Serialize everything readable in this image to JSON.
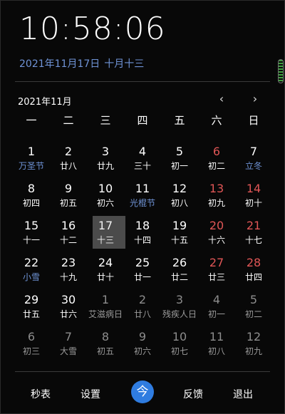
{
  "clock": {
    "time": "10:58:06"
  },
  "date_line": {
    "solar": "2021年11月17日",
    "lunar": "十月十三"
  },
  "month": {
    "label": "2021年11月",
    "prev_icon": "‹",
    "next_icon": "›"
  },
  "weekdays": [
    "一",
    "二",
    "三",
    "四",
    "五",
    "六",
    "日"
  ],
  "days": [
    {
      "n": "1",
      "l": "万圣节",
      "t": "festival"
    },
    {
      "n": "2",
      "l": "廿八",
      "t": ""
    },
    {
      "n": "3",
      "l": "廿九",
      "t": ""
    },
    {
      "n": "4",
      "l": "三十",
      "t": ""
    },
    {
      "n": "5",
      "l": "初一",
      "t": ""
    },
    {
      "n": "6",
      "l": "初二",
      "t": "weekend"
    },
    {
      "n": "7",
      "l": "立冬",
      "t": "festival"
    },
    {
      "n": "8",
      "l": "初四",
      "t": ""
    },
    {
      "n": "9",
      "l": "初五",
      "t": ""
    },
    {
      "n": "10",
      "l": "初六",
      "t": ""
    },
    {
      "n": "11",
      "l": "光棍节",
      "t": "festival"
    },
    {
      "n": "12",
      "l": "初八",
      "t": ""
    },
    {
      "n": "13",
      "l": "初九",
      "t": "weekend"
    },
    {
      "n": "14",
      "l": "初十",
      "t": "weekend"
    },
    {
      "n": "15",
      "l": "十一",
      "t": ""
    },
    {
      "n": "16",
      "l": "十二",
      "t": ""
    },
    {
      "n": "17",
      "l": "十三",
      "t": "today"
    },
    {
      "n": "18",
      "l": "十四",
      "t": ""
    },
    {
      "n": "19",
      "l": "十五",
      "t": ""
    },
    {
      "n": "20",
      "l": "十六",
      "t": "weekend"
    },
    {
      "n": "21",
      "l": "十七",
      "t": "weekend"
    },
    {
      "n": "22",
      "l": "小雪",
      "t": "festival"
    },
    {
      "n": "23",
      "l": "十九",
      "t": ""
    },
    {
      "n": "24",
      "l": "廿十",
      "t": ""
    },
    {
      "n": "25",
      "l": "廿一",
      "t": ""
    },
    {
      "n": "26",
      "l": "廿二",
      "t": ""
    },
    {
      "n": "27",
      "l": "廿三",
      "t": "weekend"
    },
    {
      "n": "28",
      "l": "廿四",
      "t": "weekend"
    },
    {
      "n": "29",
      "l": "廿五",
      "t": ""
    },
    {
      "n": "30",
      "l": "廿六",
      "t": ""
    },
    {
      "n": "1",
      "l": "艾滋病日",
      "t": "other"
    },
    {
      "n": "2",
      "l": "廿八",
      "t": "other"
    },
    {
      "n": "3",
      "l": "残疾人日",
      "t": "other"
    },
    {
      "n": "4",
      "l": "初一",
      "t": "other"
    },
    {
      "n": "5",
      "l": "初二",
      "t": "other"
    },
    {
      "n": "6",
      "l": "初三",
      "t": "other"
    },
    {
      "n": "7",
      "l": "大雪",
      "t": "other"
    },
    {
      "n": "8",
      "l": "初五",
      "t": "other"
    },
    {
      "n": "9",
      "l": "初六",
      "t": "other"
    },
    {
      "n": "10",
      "l": "初七",
      "t": "other"
    },
    {
      "n": "11",
      "l": "初八",
      "t": "other"
    },
    {
      "n": "12",
      "l": "初九",
      "t": "other"
    }
  ],
  "toolbar": {
    "stopwatch": "秒表",
    "settings": "设置",
    "today": "今",
    "feedback": "反馈",
    "exit": "退出"
  },
  "colors": {
    "accent": "#2f7ce0",
    "festival": "#6f93d6",
    "weekend": "#e05656",
    "today_bg": "#4b4b4b"
  }
}
